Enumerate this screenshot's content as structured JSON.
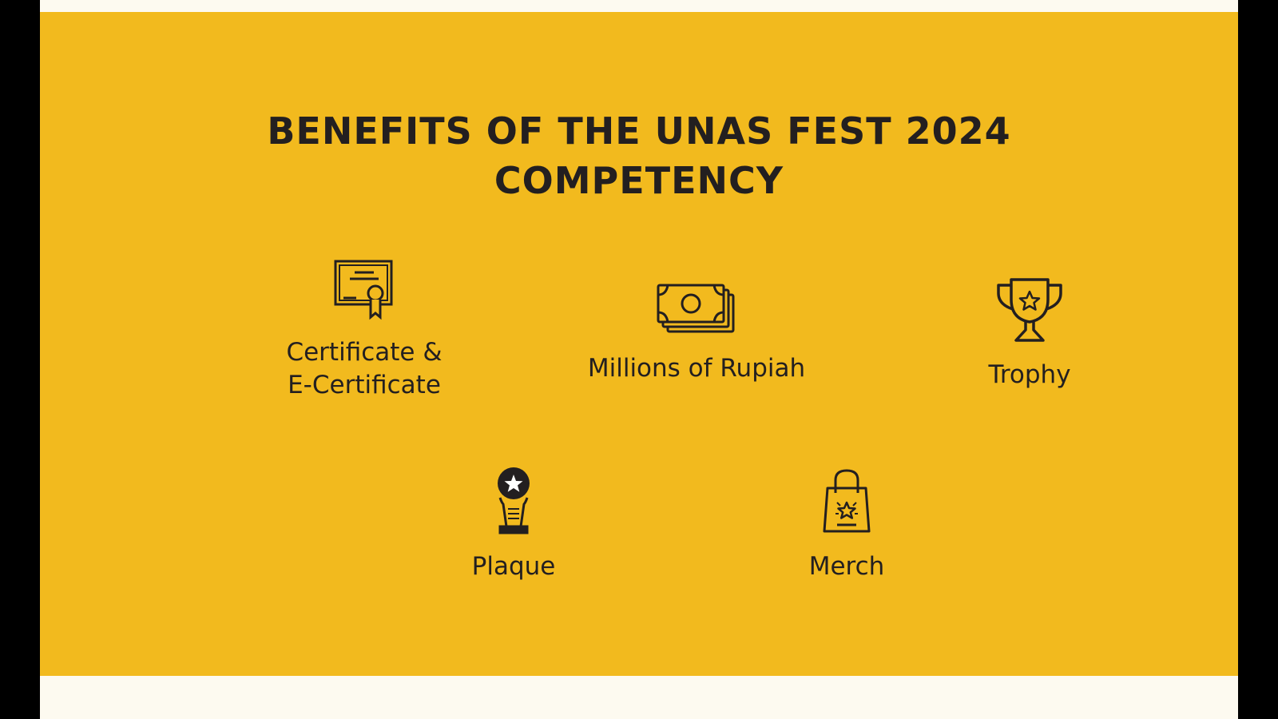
{
  "title": {
    "line1": "Benefits of the UNAS FEST 2024",
    "line2": "Competency"
  },
  "benefits": [
    {
      "label_line1": "Certificate &",
      "label_line2": "E-Certificate",
      "icon": "certificate-icon"
    },
    {
      "label": "Millions of Rupiah",
      "icon": "money-icon"
    },
    {
      "label": "Trophy",
      "icon": "trophy-icon"
    },
    {
      "label": "Plaque",
      "icon": "plaque-icon"
    },
    {
      "label": "Merch",
      "icon": "shopping-bag-icon"
    }
  ],
  "colors": {
    "background": "#f2ba1e",
    "text": "#231f20",
    "frame": "#fdfaf0"
  }
}
